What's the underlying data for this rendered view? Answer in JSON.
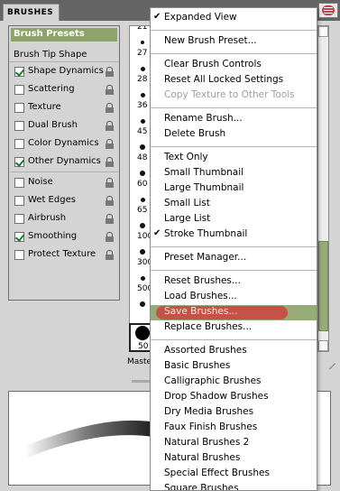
{
  "panel": {
    "tab_title": "BRUSHES",
    "brush_presets_label": "Brush Presets",
    "brush_tip_shape_label": "Brush Tip Shape",
    "options": [
      {
        "label": "Shape Dynamics",
        "checked": true
      },
      {
        "label": "Scattering",
        "checked": false
      },
      {
        "label": "Texture",
        "checked": false
      },
      {
        "label": "Dual Brush",
        "checked": false
      },
      {
        "label": "Color Dynamics",
        "checked": false
      },
      {
        "label": "Other Dynamics",
        "checked": true
      },
      {
        "label": "Noise",
        "checked": false
      },
      {
        "label": "Wet Edges",
        "checked": false
      },
      {
        "label": "Airbrush",
        "checked": false
      },
      {
        "label": "Smoothing",
        "checked": true
      },
      {
        "label": "Protect Texture",
        "checked": false
      }
    ],
    "brush_sizes": [
      "21",
      "27",
      "28",
      "36",
      "45",
      "48",
      "60",
      "65",
      "100",
      "300",
      "500"
    ],
    "selected_brush_size": "50",
    "master_diameter_label": "Maste"
  },
  "menu": {
    "items": [
      {
        "label": "Expanded View",
        "checked": true
      },
      {
        "divider": true
      },
      {
        "label": "New Brush Preset..."
      },
      {
        "divider": true
      },
      {
        "label": "Clear Brush Controls"
      },
      {
        "label": "Reset All Locked Settings"
      },
      {
        "label": "Copy Texture to Other Tools",
        "disabled": true
      },
      {
        "divider": true
      },
      {
        "label": "Rename Brush..."
      },
      {
        "label": "Delete Brush"
      },
      {
        "divider": true
      },
      {
        "label": "Text Only"
      },
      {
        "label": "Small Thumbnail"
      },
      {
        "label": "Large Thumbnail"
      },
      {
        "label": "Small List"
      },
      {
        "label": "Large List"
      },
      {
        "label": "Stroke Thumbnail",
        "checked": true
      },
      {
        "divider": true
      },
      {
        "label": "Preset Manager..."
      },
      {
        "divider": true
      },
      {
        "label": "Reset Brushes..."
      },
      {
        "label": "Load Brushes..."
      },
      {
        "label": "Save Brushes...",
        "highlighted": true
      },
      {
        "label": "Replace Brushes..."
      },
      {
        "divider": true
      },
      {
        "label": "Assorted Brushes"
      },
      {
        "label": "Basic Brushes"
      },
      {
        "label": "Calligraphic Brushes"
      },
      {
        "label": "Drop Shadow Brushes"
      },
      {
        "label": "Dry Media Brushes"
      },
      {
        "label": "Faux Finish Brushes"
      },
      {
        "label": "Natural Brushes 2"
      },
      {
        "label": "Natural Brushes"
      },
      {
        "label": "Special Effect Brushes"
      },
      {
        "label": "Square Brushes"
      }
    ]
  },
  "colors": {
    "accent_green": "#97ab76",
    "highlight_red": "#c55248",
    "check_green": "#1c7a2e"
  }
}
